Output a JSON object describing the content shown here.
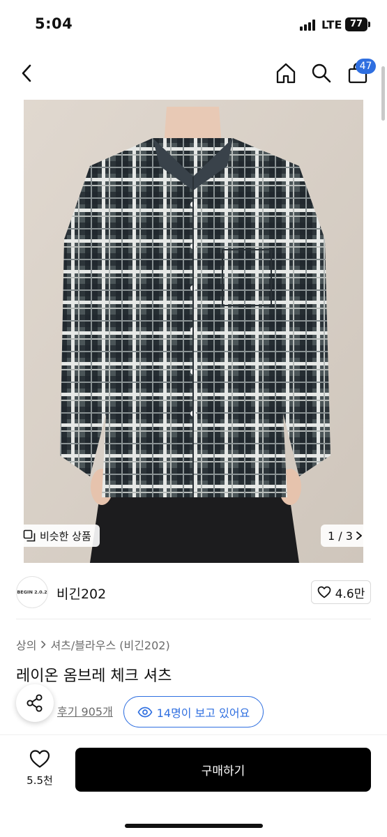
{
  "status_bar": {
    "time": "5:04",
    "network": "LTE",
    "battery": "77"
  },
  "nav": {
    "cart_count": "47"
  },
  "product": {
    "image": {
      "similar_label": "비슷한 상품",
      "page_counter": "1 / 3"
    },
    "brand": {
      "logo_text": "BEGIN 2.0.2",
      "name": "비긴202",
      "likes": "4.6만"
    },
    "breadcrumb": [
      "상의",
      "셔츠/블라우스 (비긴202)"
    ],
    "title": "레이온 옴브레 체크 셔츠",
    "review_text": "후기 905개",
    "viewers_text": "14명이 보고 있어요"
  },
  "bottom_bar": {
    "wish_count": "5.5천",
    "buy_label": "구매하기"
  },
  "colors": {
    "accent": "#2f6fe0",
    "buy_button": "#000000"
  }
}
